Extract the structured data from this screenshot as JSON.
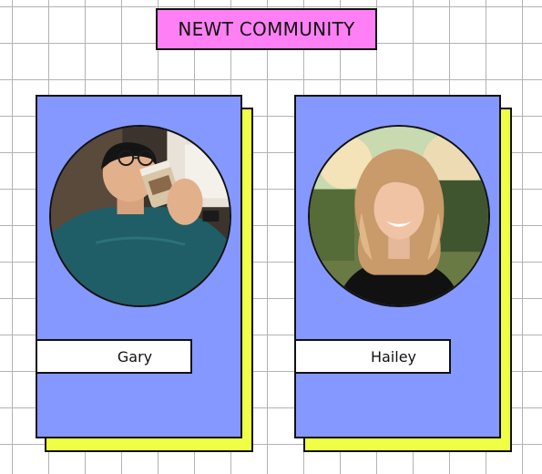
{
  "header": {
    "title": "NEWT COMMUNITY"
  },
  "members": [
    {
      "name": "Gary",
      "photo_icon": "man-drinking-coffee-photo"
    },
    {
      "name": "Hailey",
      "photo_icon": "smiling-woman-photo"
    }
  ],
  "colors": {
    "title_background": "#ff80f4",
    "card_background": "#8598ff",
    "card_shadow": "#eeff45",
    "grid_lines": "#b3b3b3",
    "border": "#111111"
  }
}
